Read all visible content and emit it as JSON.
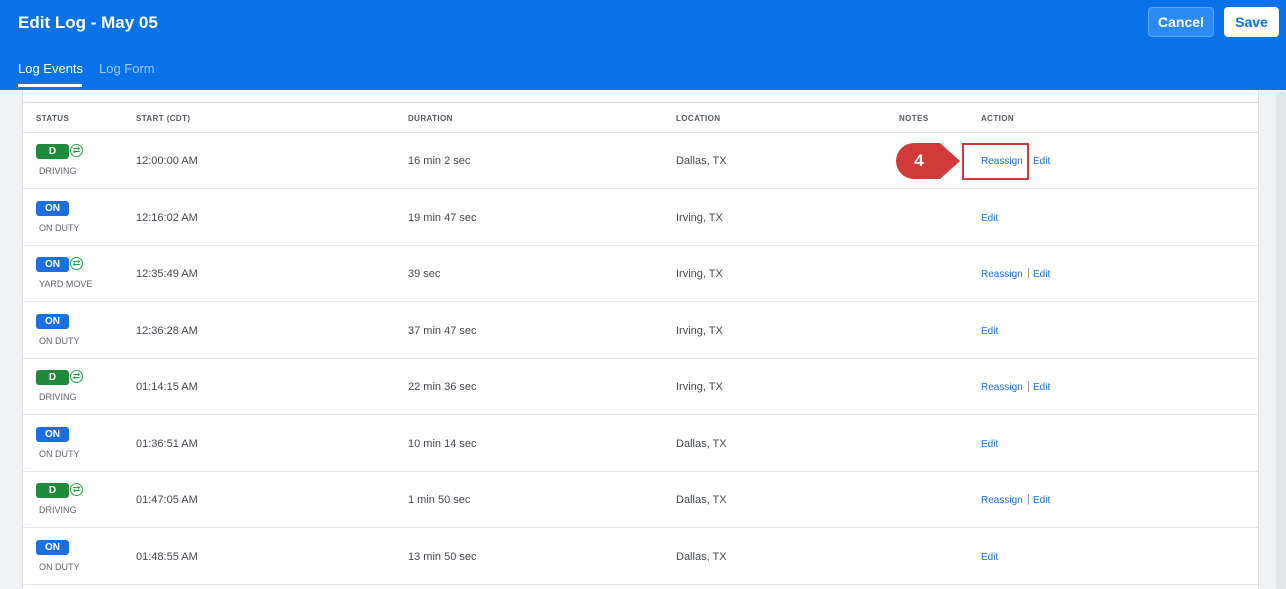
{
  "header": {
    "title": "Edit Log - May 05",
    "cancel_label": "Cancel",
    "save_label": "Save",
    "tabs": [
      {
        "label": "Log Events",
        "active": true
      },
      {
        "label": "Log Form",
        "active": false
      }
    ]
  },
  "table": {
    "columns": [
      "STATUS",
      "START (CDT)",
      "DURATION",
      "LOCATION",
      "NOTES",
      "ACTION"
    ],
    "rows": [
      {
        "badge": "D",
        "badge_type": "d",
        "swap": true,
        "status": "DRIVING",
        "start": "12:00:00 AM",
        "duration": "16 min 2 sec",
        "location": "Dallas, TX",
        "reassign": "Reassign",
        "edit": "Edit"
      },
      {
        "badge": "ON",
        "badge_type": "on",
        "swap": false,
        "status": "ON DUTY",
        "start": "12:16:02 AM",
        "duration": "19 min 47 sec",
        "location": "Irving, TX",
        "reassign": "",
        "edit": "Edit"
      },
      {
        "badge": "ON",
        "badge_type": "on",
        "swap": true,
        "status": "YARD MOVE",
        "start": "12:35:49 AM",
        "duration": "39 sec",
        "location": "Irving, TX",
        "reassign": "Reassign",
        "edit": "Edit"
      },
      {
        "badge": "ON",
        "badge_type": "on",
        "swap": false,
        "status": "ON DUTY",
        "start": "12:36:28 AM",
        "duration": "37 min 47 sec",
        "location": "Irving, TX",
        "reassign": "",
        "edit": "Edit"
      },
      {
        "badge": "D",
        "badge_type": "d",
        "swap": true,
        "status": "DRIVING",
        "start": "01:14:15 AM",
        "duration": "22 min 36 sec",
        "location": "Irving, TX",
        "reassign": "Reassign",
        "edit": "Edit"
      },
      {
        "badge": "ON",
        "badge_type": "on",
        "swap": false,
        "status": "ON DUTY",
        "start": "01:36:51 AM",
        "duration": "10 min 14 sec",
        "location": "Dallas, TX",
        "reassign": "",
        "edit": "Edit"
      },
      {
        "badge": "D",
        "badge_type": "d",
        "swap": true,
        "status": "DRIVING",
        "start": "01:47:05 AM",
        "duration": "1 min 50 sec",
        "location": "Dallas, TX",
        "reassign": "Reassign",
        "edit": "Edit"
      },
      {
        "badge": "ON",
        "badge_type": "on",
        "swap": false,
        "status": "ON DUTY",
        "start": "01:48:55 AM",
        "duration": "13 min 50 sec",
        "location": "Dallas, TX",
        "reassign": "",
        "edit": "Edit"
      }
    ]
  },
  "callout": {
    "number": "4",
    "color": "#d23a3a"
  },
  "icons": {
    "swap": "swap-arrows-icon"
  }
}
